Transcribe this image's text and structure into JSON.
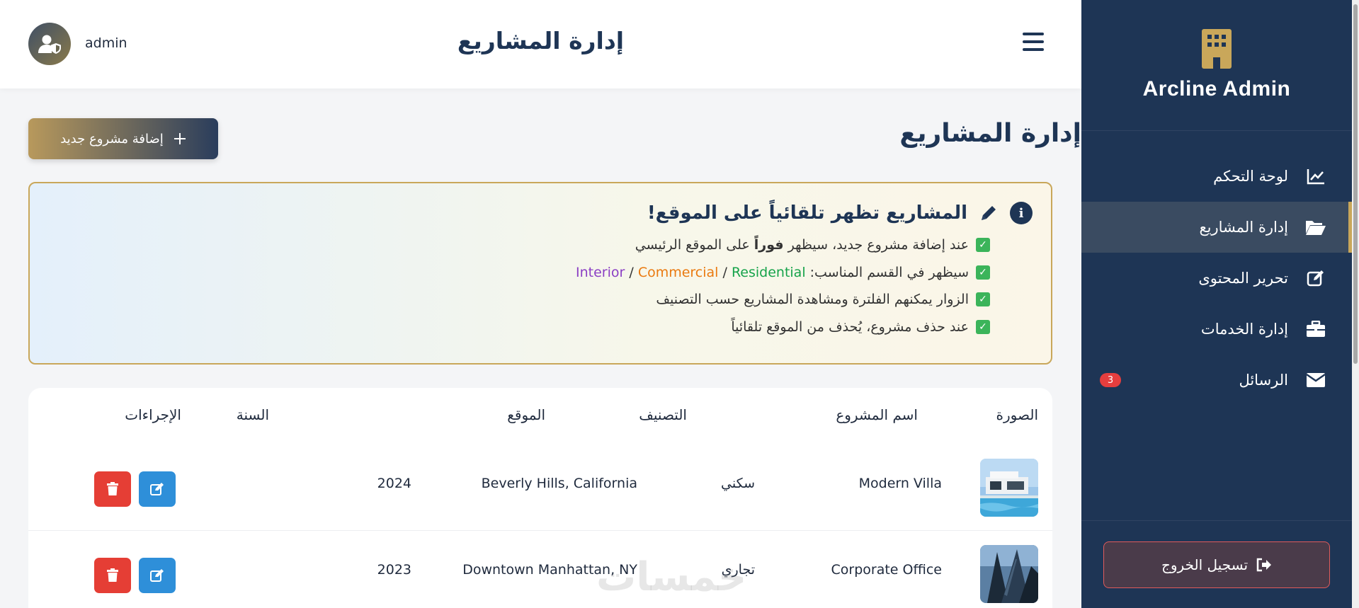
{
  "header": {
    "title": "إدارة المشاريع",
    "username": "admin"
  },
  "sidebar": {
    "brand": "Arcline Admin",
    "items": [
      {
        "label": "لوحة التحكم",
        "icon": "chart-line-icon"
      },
      {
        "label": "إدارة المشاريع",
        "icon": "folder-open-icon",
        "active": true
      },
      {
        "label": "تحرير المحتوى",
        "icon": "edit-square-icon"
      },
      {
        "label": "إدارة الخدمات",
        "icon": "briefcase-icon"
      },
      {
        "label": "الرسائل",
        "icon": "envelope-icon",
        "badge": "3"
      }
    ],
    "logout": "تسجيل الخروج"
  },
  "main": {
    "title": "إدارة المشاريع",
    "add_button": "إضافة مشروع جديد",
    "info": {
      "heading": "المشاريع تظهر تلقائياً على الموقع!",
      "line1_a": "عند إضافة مشروع جديد، سيظهر ",
      "line1_bold": "فوراً",
      "line1_b": " على الموقع الرئيسي",
      "line2_a": "سيظهر في القسم المناسب: ",
      "line2_interior": "Interior",
      "line2_sep1": " / ",
      "line2_commercial": "Commercial",
      "line2_sep2": " / ",
      "line2_residential": "Residential",
      "line3": "الزوار يمكنهم الفلترة ومشاهدة المشاريع حسب التصنيف",
      "line4": "عند حذف مشروع، يُحذف من الموقع تلقائياً"
    },
    "table": {
      "headers": {
        "image": "الصورة",
        "name": "اسم المشروع",
        "category": "التصنيف",
        "location": "الموقع",
        "year": "السنة",
        "actions": "الإجراءات"
      },
      "rows": [
        {
          "name": "Modern Villa",
          "category": "سكني",
          "location": "Beverly Hills, California",
          "year": "2024"
        },
        {
          "name": "Corporate Office",
          "category": "تجاري",
          "location": "Downtown Manhattan, NY",
          "year": "2023"
        }
      ]
    }
  },
  "watermark": "خمسات",
  "colors": {
    "navy": "#1e3555",
    "gold": "#c9a75a",
    "danger": "#e53e35",
    "info": "#2e8fd9"
  }
}
